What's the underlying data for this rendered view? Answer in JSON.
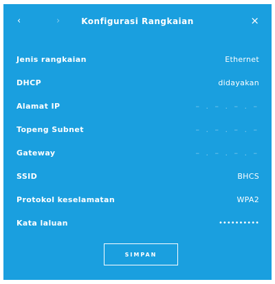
{
  "header": {
    "back_icon": "‹",
    "forward_icon": "›",
    "title": "Konfigurasi Rangkaian",
    "close_icon": "×"
  },
  "rows": [
    {
      "label": "Jenis rangkaian",
      "value": "Ethernet"
    },
    {
      "label": "DHCP",
      "value": "didayakan"
    },
    {
      "label": "Alamat IP",
      "value": "– . – . – . –"
    },
    {
      "label": "Topeng Subnet",
      "value": "– . – . – . –"
    },
    {
      "label": "Gateway",
      "value": "– . – . – . –"
    },
    {
      "label": "SSID",
      "value": "BHCS"
    },
    {
      "label": "Protokol keselamatan",
      "value": "WPA2"
    },
    {
      "label": "Kata laluan",
      "value": "••••••••••"
    }
  ],
  "save_label": "SIMPAN",
  "colors": {
    "panel_bg": "#1a9fdf",
    "text": "#ffffff"
  }
}
